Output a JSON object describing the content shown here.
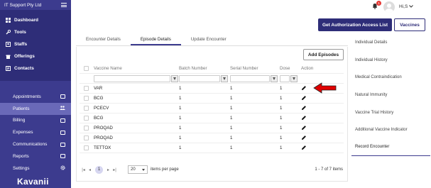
{
  "sidebar": {
    "org_name": "IT Support Pty Ltd",
    "top_items": [
      {
        "label": "Dashboard",
        "icon": "dashboard-icon"
      },
      {
        "label": "Tools",
        "icon": "wrench-icon"
      },
      {
        "label": "Staffs",
        "icon": "staff-icon"
      },
      {
        "label": "Offerings",
        "icon": "offerings-icon"
      },
      {
        "label": "Contacts",
        "icon": "contacts-icon"
      }
    ],
    "items": [
      {
        "label": "Appointments",
        "icon": "calendar-icon"
      },
      {
        "label": "Patients",
        "icon": "people-icon",
        "active": true
      },
      {
        "label": "Billing",
        "icon": "card-icon"
      },
      {
        "label": "Expenses",
        "icon": "expenses-icon"
      },
      {
        "label": "Communications",
        "icon": "chat-icon"
      },
      {
        "label": "Reports",
        "icon": "image-icon"
      },
      {
        "label": "Settings",
        "icon": "gear-icon"
      }
    ],
    "logo": "Kavanii"
  },
  "topbar": {
    "notification_count": "1",
    "user": "Hi,S"
  },
  "actions": {
    "auth_button": "Get Authorization Access List",
    "vaccines_button": "Vaccines",
    "add_episodes": "Add Episodes"
  },
  "tabs": [
    {
      "label": "Encounter Details"
    },
    {
      "label": "Episode Details",
      "active": true
    },
    {
      "label": "Update Encounter"
    }
  ],
  "table": {
    "columns": [
      "Vaccine Name",
      "Batch Number",
      "Serial Number",
      "Dose",
      "Action"
    ],
    "rows": [
      {
        "vaccine": "VAR",
        "batch": "1",
        "serial": "1",
        "dose": "1"
      },
      {
        "vaccine": "BCG",
        "batch": "1",
        "serial": "1",
        "dose": "1"
      },
      {
        "vaccine": "PCECV",
        "batch": "1",
        "serial": "1",
        "dose": "1"
      },
      {
        "vaccine": "BCG",
        "batch": "1",
        "serial": "1",
        "dose": "1"
      },
      {
        "vaccine": "PROQAD",
        "batch": "1",
        "serial": "1",
        "dose": "1"
      },
      {
        "vaccine": "PROQAD",
        "batch": "1",
        "serial": "1",
        "dose": "1"
      },
      {
        "vaccine": "TETTOX",
        "batch": "1",
        "serial": "1",
        "dose": "1"
      }
    ]
  },
  "pager": {
    "current_page": "1",
    "page_size": "20",
    "page_size_label": "items per page",
    "info": "1 - 7 of 7 items"
  },
  "right_menu": [
    {
      "label": "Individual Details"
    },
    {
      "label": "Individual History"
    },
    {
      "label": "Medical Contraindication"
    },
    {
      "label": "Natural Immunity"
    },
    {
      "label": "Vaccine Trial History"
    },
    {
      "label": "Additional Vaccine Indicator"
    },
    {
      "label": "Record Encounter",
      "active": true
    }
  ],
  "colors": {
    "sidebar": "#3c3b8e",
    "sidebar_dark": "#2e2d78",
    "active_item": "#6a69b8",
    "annotation_arrow": "#e00000"
  }
}
